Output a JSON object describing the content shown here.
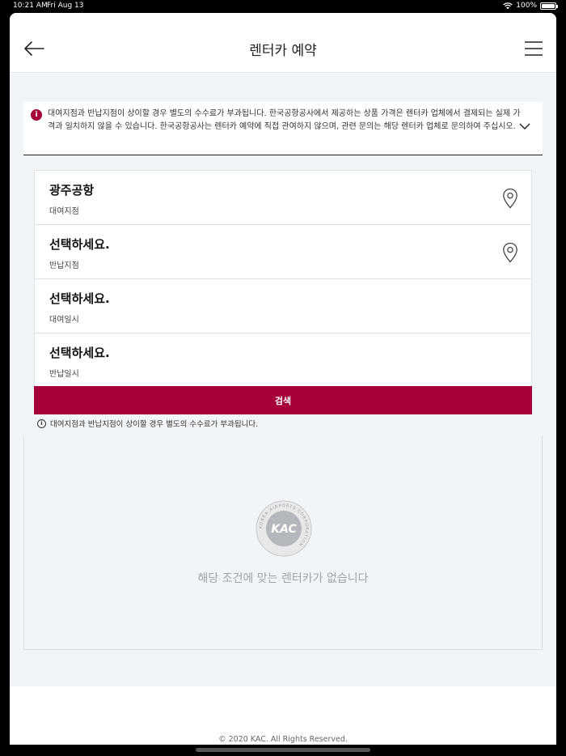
{
  "status_bar": {
    "time": "10:21 AM",
    "date": "Fri Aug 13",
    "battery": "100%",
    "wifi_icon": "wifi-icon",
    "battery_icon": "battery-icon"
  },
  "header": {
    "title": "렌터카 예약",
    "back_icon": "arrow-left-icon",
    "menu_icon": "hamburger-menu-icon"
  },
  "notice": {
    "icon": "info-icon",
    "text": "대여지점과 반납지점이 상이할 경우 별도의 수수료가 부과됩니다. 한국공항공사에서 제공하는 상품 가격은 렌터카 업체에서 결제되는 실제 가격과 일치하지 않을 수 있습니다. 한국공항공사는 렌터카 예약에 직접 관여하지 않으며, 관련 문의는 해당 렌터카 업체로 문의하여 주십시오.",
    "expand_icon": "chevron-down-icon"
  },
  "form": {
    "fields": [
      {
        "value": "광주공항",
        "label": "대여지점",
        "icon": "location-pin-icon"
      },
      {
        "value": "선택하세요.",
        "label": "반납지점",
        "icon": "location-pin-icon"
      },
      {
        "value": "선택하세요.",
        "label": "대여일시"
      },
      {
        "value": "선택하세요.",
        "label": "반납일시"
      }
    ],
    "search_label": "검색"
  },
  "hint": {
    "icon": "info-circle-icon",
    "text": "대여지점과 반납지점이 상이할 경우 별도의 수수료가 부과됩니다."
  },
  "results": {
    "logo_text": "KAC",
    "logo_ring_text": "KOREA AIRPORTS CORPORATION",
    "empty_message": "해당 조건에 맞는 렌터카가 없습니다"
  },
  "footer": {
    "copyright": "© 2020 KAC. All Rights Reserved."
  },
  "colors": {
    "accent": "#a6003a",
    "background": "#f2f5f8"
  }
}
